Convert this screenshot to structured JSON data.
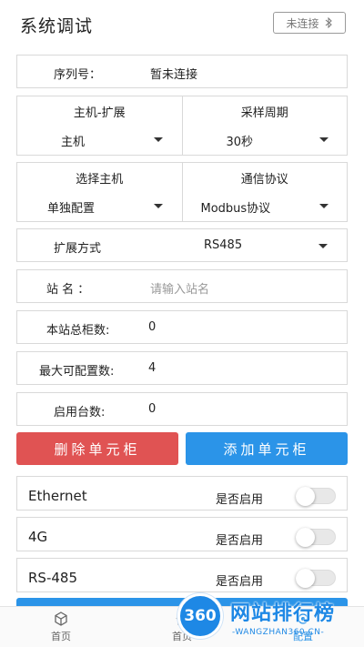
{
  "header": {
    "title": "系统调试",
    "connection_button": "未连接",
    "connection_icon": "bluetooth-icon"
  },
  "serial": {
    "label": "序列号：",
    "value": "暂未连接"
  },
  "host_expand": {
    "label": "主机-扩展",
    "value": "主机"
  },
  "sample_period": {
    "label": "采样周期",
    "value": "30秒"
  },
  "select_host": {
    "label": "选择主机",
    "value": "单独配置"
  },
  "protocol": {
    "label": "通信协议",
    "value": "Modbus协议"
  },
  "expand_mode": {
    "label": "扩展方式",
    "value": "RS485"
  },
  "station_name": {
    "label": "站  名 ：",
    "placeholder": "请输入站名"
  },
  "total_cabinets": {
    "label": "本站总柜数:",
    "value": "0"
  },
  "max_config": {
    "label": "最大可配置数:",
    "value": "4"
  },
  "enabled_units": {
    "label": "启用台数:",
    "value": "0"
  },
  "buttons": {
    "delete": "删除单元柜",
    "add": "添加单元柜"
  },
  "interfaces": [
    {
      "name": "Ethernet",
      "enable_label": "是否启用",
      "enabled": false
    },
    {
      "name": "4G",
      "enable_label": "是否启用",
      "enabled": false
    },
    {
      "name": "RS-485",
      "enable_label": "是否启用",
      "enabled": false
    }
  ],
  "tabbar": {
    "items": [
      {
        "label": "首页",
        "icon": "cube-icon"
      },
      {
        "label": "首页",
        "icon": "home-icon"
      },
      {
        "label": "配置",
        "icon": "config-icon"
      }
    ]
  },
  "watermark": {
    "logo": "360",
    "text": "网站排行榜",
    "sub": "-WANGZHAN360.CN-"
  },
  "colors": {
    "danger": "#e05353",
    "primary": "#2b94e8",
    "border": "#d9d9d9"
  }
}
